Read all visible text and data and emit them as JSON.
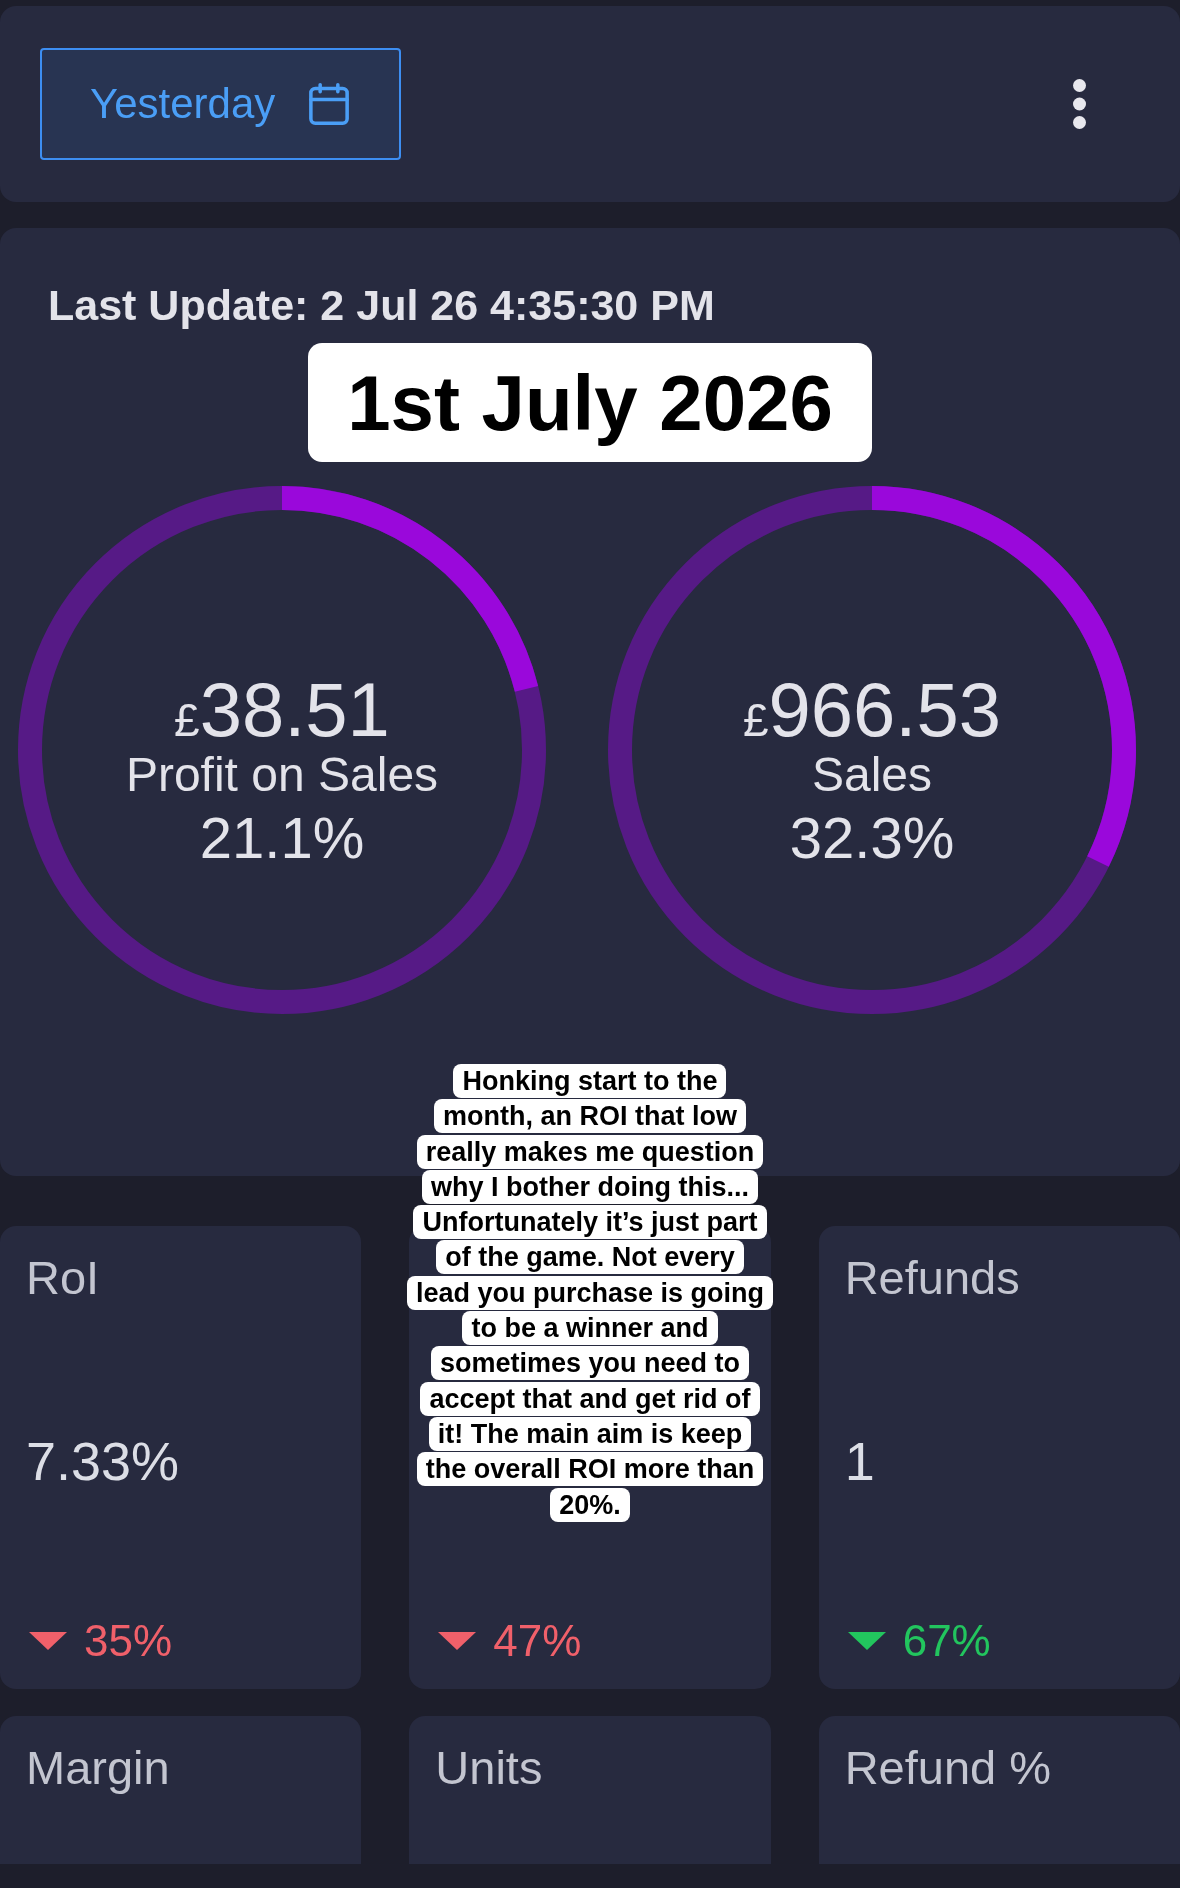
{
  "toolbar": {
    "date_button": {
      "label": "Yesterday"
    }
  },
  "summary": {
    "last_update": "Last Update: 2 Jul 26 4:35:30 PM",
    "gauges": [
      {
        "currency": "£",
        "amount": "38.51",
        "label": "Profit on Sales",
        "percent": "21.1%",
        "level": 0.211
      },
      {
        "currency": "£",
        "amount": "966.53",
        "label": "Sales",
        "percent": "32.3%",
        "level": 0.323
      }
    ]
  },
  "stats": [
    {
      "label": "RoI",
      "value": "7.33%",
      "change": {
        "kind": "down",
        "text": "35%",
        "color": "#f0606a"
      }
    },
    {
      "change": {
        "kind": "down",
        "text": "47%",
        "color": "#f0606a"
      }
    },
    {
      "label": "Refunds",
      "value": "1",
      "change": {
        "kind": "down",
        "text": "67%",
        "color": "#22c55e"
      }
    },
    {
      "label": "Margin"
    },
    {
      "label": "Units"
    },
    {
      "label": "Refund %"
    }
  ],
  "overlays": {
    "date_caption": "1st July 2026",
    "commentary": "Honking start to the\nmonth, an ROI that low\nreally makes me question\nwhy I bother doing this...\nUnfortunately it’s just part\nof the game. Not every\nlead you purchase is going\nto be a winner and\nsometimes you need to\naccept that and get rid of\nit! The main aim is keep\nthe overall ROI more than\n20%."
  }
}
